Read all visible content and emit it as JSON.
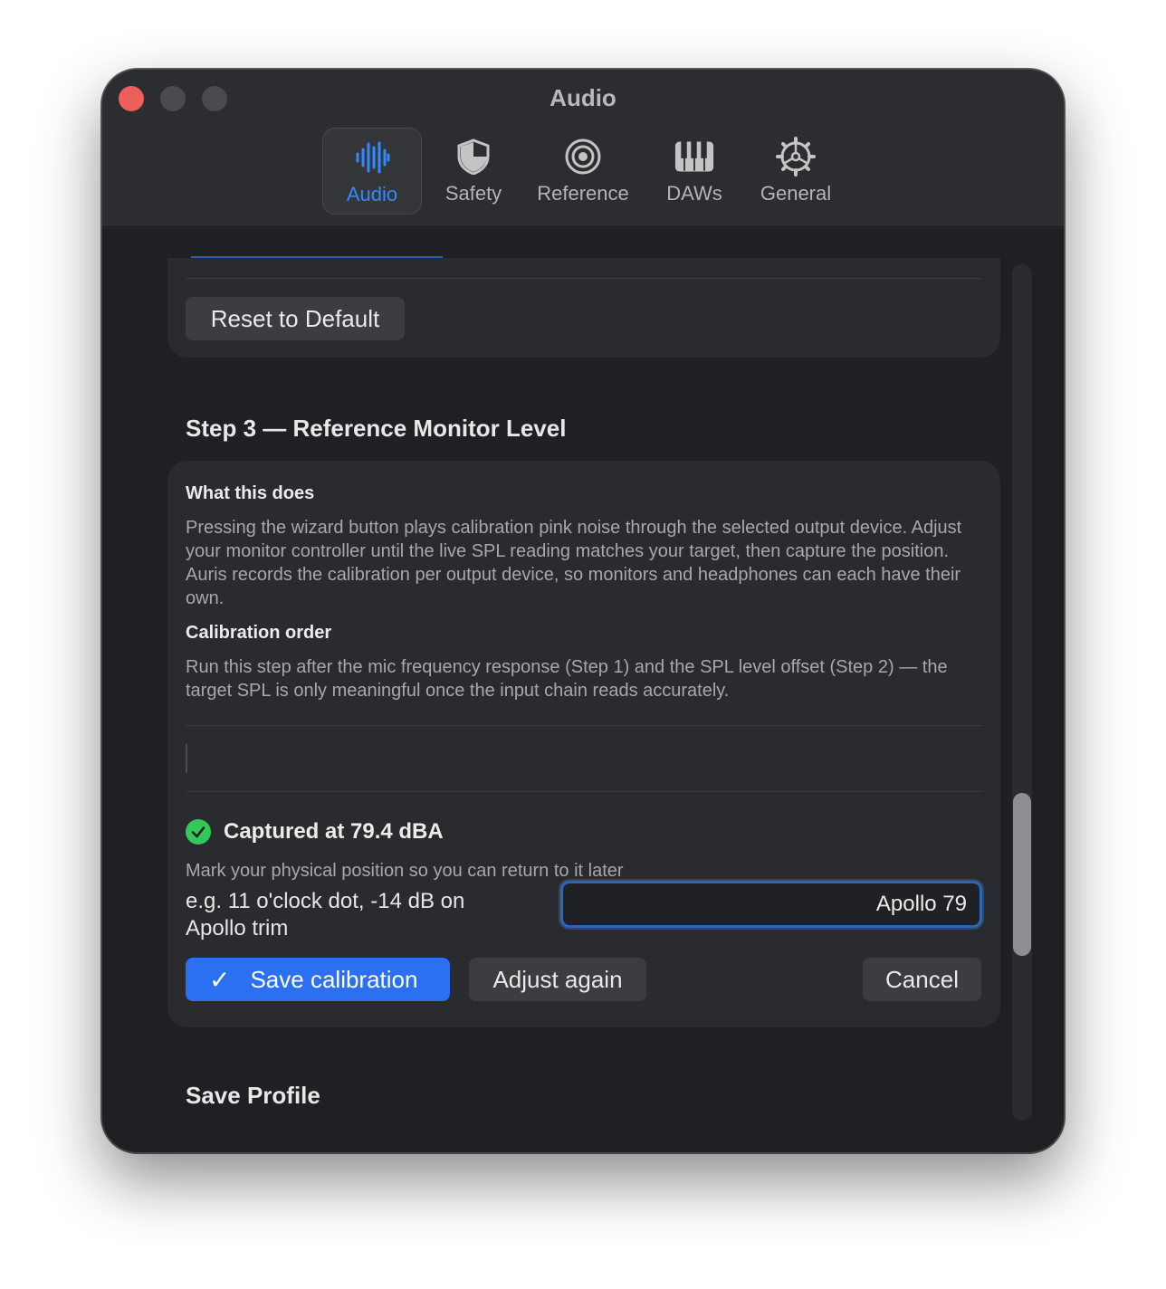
{
  "window": {
    "title": "Audio"
  },
  "tabs": [
    {
      "label": "Audio",
      "icon": "waveform-icon",
      "active": true
    },
    {
      "label": "Safety",
      "icon": "shield-icon",
      "active": false
    },
    {
      "label": "Reference",
      "icon": "target-icon",
      "active": false
    },
    {
      "label": "DAWs",
      "icon": "piano-keys-icon",
      "active": false
    },
    {
      "label": "General",
      "icon": "gear-icon",
      "active": false
    }
  ],
  "section_top": {
    "reset_label": "Reset to Default"
  },
  "step3": {
    "heading": "Step 3 — Reference Monitor Level",
    "what_title": "What this does",
    "what_body": "Pressing the wizard button plays calibration pink noise through the selected output device. Adjust your monitor controller until the live SPL reading matches your target, then capture the position. Auris records the calibration per output device, so monitors and headphones can each have their own.",
    "order_title": "Calibration order",
    "order_body": "Run this step after the mic frequency response (Step 1) and the SPL level offset (Step 2) — the target SPL is only meaningful once the input chain reads accurately.",
    "captured_text": "Captured at 79.4 dBA",
    "mark_hint": "Mark your physical position so you can return to it later",
    "name_placeholder_label": "e.g. 11 o'clock dot, -14 dB on Apollo trim",
    "name_value": "Apollo 79",
    "save_label": "Save calibration",
    "save_glyph": "✓",
    "adjust_label": "Adjust again",
    "cancel_label": "Cancel"
  },
  "save_profile": {
    "heading": "Save Profile"
  },
  "colors": {
    "accent": "#2a70f0",
    "success": "#34c759",
    "close": "#ec5f5a"
  }
}
